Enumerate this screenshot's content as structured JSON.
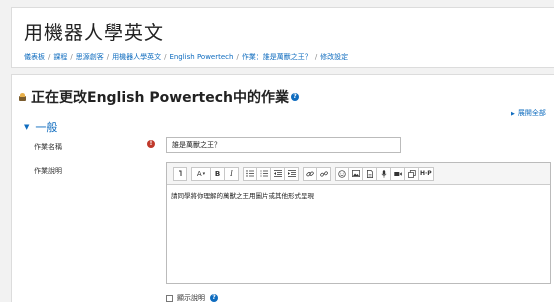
{
  "header": {
    "site_title": "用機器人學英文",
    "breadcrumb": [
      "儀表板",
      "課程",
      "思源創客",
      "用機器人學英文",
      "English Powertech",
      "作業：誰是萬獸之王？",
      "修改設定"
    ]
  },
  "main": {
    "heading": "正在更改English Powertech中的作業",
    "expand_all": "展開全部",
    "section_title": "一般",
    "name_label": "作業名稱",
    "name_value": "誰是萬獸之王？",
    "desc_label": "作業說明",
    "desc_content": "請同學將你理解的萬獸之王用圖片或其他形式呈現",
    "show_desc_label": "顯示說明",
    "toolbar": {
      "format_glyph": "A",
      "bold_glyph": "B",
      "italic_glyph": "I",
      "h5p_glyph": "H·P"
    }
  },
  "colors": {
    "accent": "#0f6cbf",
    "required": "#c0392b"
  }
}
